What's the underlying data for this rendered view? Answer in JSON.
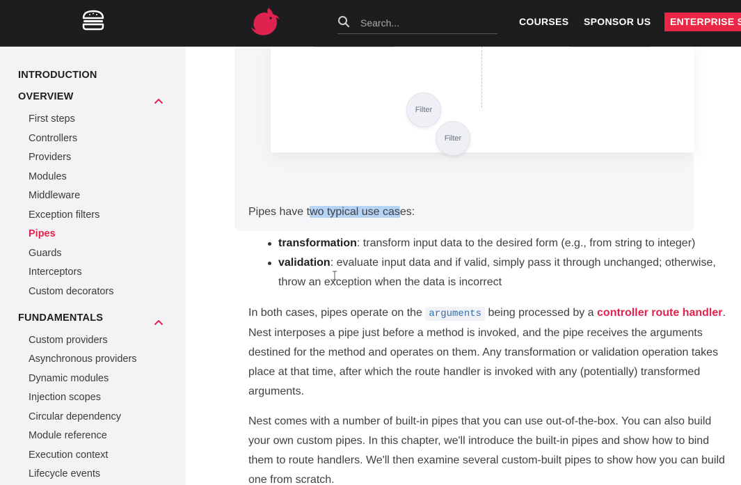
{
  "header": {
    "search_placeholder": "Search...",
    "nav": {
      "courses": "COURSES",
      "sponsor": "SPONSOR US",
      "enterprise": "ENTERPRISE SU"
    },
    "brand_color": "#e0234e"
  },
  "sidebar": {
    "introduction": "INTRODUCTION",
    "overview": {
      "title": "OVERVIEW",
      "items": [
        "First steps",
        "Controllers",
        "Providers",
        "Modules",
        "Middleware",
        "Exception filters",
        "Pipes",
        "Guards",
        "Interceptors",
        "Custom decorators"
      ],
      "active": "Pipes"
    },
    "fundamentals": {
      "title": "FUNDAMENTALS",
      "items": [
        "Custom providers",
        "Asynchronous providers",
        "Dynamic modules",
        "Injection scopes",
        "Circular dependency",
        "Module reference",
        "Execution context",
        "Lifecycle events"
      ]
    }
  },
  "diagram": {
    "filter_a": "Filter",
    "filter_b": "Filter"
  },
  "content": {
    "intro_before": "Pipes have t",
    "intro_highlight": "wo typical use cas",
    "intro_after": "es:",
    "bullets": [
      {
        "term": "transformation",
        "text": ": transform input data to the desired form (e.g., from string to integer)"
      },
      {
        "term": "validation",
        "text": ": evaluate input data and if valid, simply pass it through unchanged; otherwise, throw an exception when the data is incorrect"
      }
    ],
    "p2_before": "In both cases, pipes operate on the ",
    "p2_code": "arguments",
    "p2_mid": " being processed by a ",
    "p2_link": "controller route handler",
    "p2_after": ". Nest interposes a pipe just before a method is invoked, and the pipe receives the arguments destined for the method and operates on them. Any transformation or validation operation takes place at that time, after which the route handler is invoked with any (potentially) transformed arguments.",
    "p3": "Nest comes with a number of built-in pipes that you can use out-of-the-box. You can also build your own custom pipes. In this chapter, we'll introduce the built-in pipes and show how to bind them to route handlers. We'll then examine several custom-built pipes to show how you can build one from scratch."
  }
}
